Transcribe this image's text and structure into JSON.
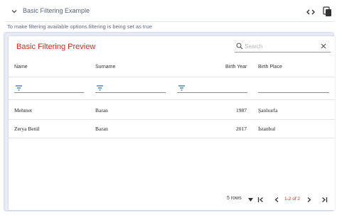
{
  "example": {
    "title": "Basic Filtering Example",
    "hint": "To make filtering available options.filtering is being set as true"
  },
  "table": {
    "title": "Basic Filtering Preview",
    "search": {
      "placeholder": "Search",
      "value": ""
    },
    "columns": [
      "Name",
      "Surname",
      "Birth Year",
      "Birth Place"
    ],
    "rows": [
      [
        "Mehmet",
        "Baran",
        "1987",
        "Şanlıurfa"
      ],
      [
        "Zerya Betül",
        "Baran",
        "2017",
        "İstanbul"
      ]
    ],
    "pagination": {
      "rows_per_page": "5 rows",
      "page_info": "1-2 of 2"
    }
  },
  "colors": {
    "title_accent": "#e0251b",
    "panel_border": "#dfe4f5",
    "filter_icon": "#2c6fa8"
  },
  "icons": [
    "chevron-down-icon",
    "code-icon",
    "copy-icon",
    "search-icon",
    "clear-icon",
    "filter-icon",
    "first-page-icon",
    "previous-page-icon",
    "next-page-icon",
    "last-page-icon"
  ]
}
